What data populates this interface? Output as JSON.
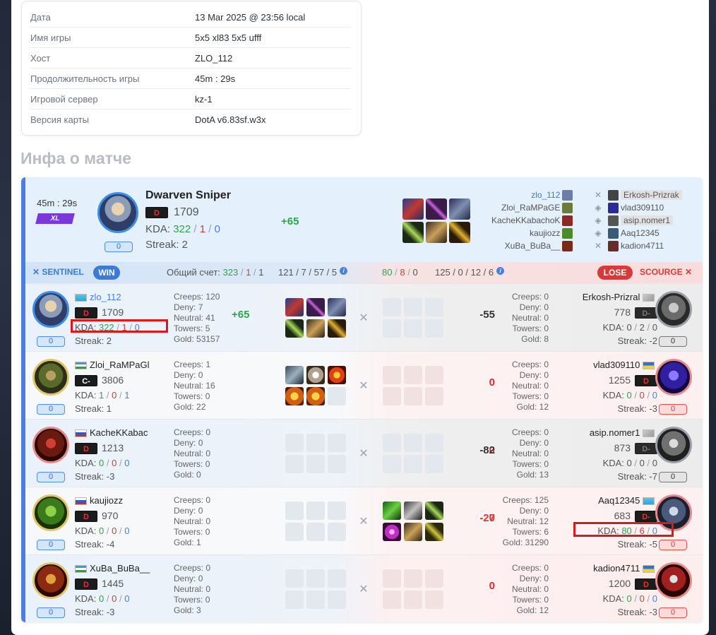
{
  "info": [
    {
      "key": "Дата",
      "value": "13 Mar 2025 @ 23:56 local"
    },
    {
      "key": "Имя игры",
      "value": "5x5 xl83 5x5 ufff"
    },
    {
      "key": "Хост",
      "value": "ZLO_112"
    },
    {
      "key": "Продолжительность игры",
      "value": "45m : 29s"
    },
    {
      "key": "Игровой сервер",
      "value": "kz-1"
    },
    {
      "key": "Версия карты",
      "value": "DotA v6.83sf.w3x"
    }
  ],
  "section_title": "Инфа о матче",
  "mvp": {
    "time": "45m : 29s",
    "badge": "XL",
    "hero": "Dwarven Sniper",
    "rank": "D",
    "rating": "1709",
    "kda_label": "KDA:",
    "k": "322",
    "d": "1",
    "a": "0",
    "streak": "Streak: 2",
    "pill": "0",
    "delta": "+65",
    "sentinel_names": [
      "zlo_112",
      "Zloi_RaMPaGE",
      "KacheKKabachoK",
      "kaujiozz",
      "XuBa_BuBa__"
    ],
    "scourge_names": [
      "Erkosh-Prizrak",
      "vlad309110",
      "asip.nomer1",
      "Aaq12345",
      "kadion4711"
    ]
  },
  "scorebar": {
    "sentinel": "SENTINEL",
    "win": "WIN",
    "total_label": "Общий счет:",
    "s_k": "323",
    "s_d": "1",
    "s_a": "1",
    "s_stats": "121 / 7 / 57 / 5",
    "c_k": "80",
    "c_d": "8",
    "c_a": "0",
    "c_stats": "125 / 0 / 12 / 6",
    "lose": "LOSE",
    "scourge": "SCOURGE"
  },
  "labels": {
    "kda": "KDA:",
    "creeps": "Creeps:",
    "deny": "Deny:",
    "neutral": "Neutral:",
    "towers": "Towers:",
    "gold": "Gold:"
  },
  "rows": [
    {
      "left": {
        "name": "zlo_112",
        "flag": "kz",
        "rank": "D",
        "rating": "1709",
        "k": "322",
        "d": "1",
        "a": "0",
        "streak": "Streak: 2",
        "pill": "0",
        "creeps": "120",
        "deny": "7",
        "neutral": "41",
        "towers": "5",
        "gold": "53157",
        "delta": "+65"
      },
      "right": {
        "name": "Erkosh-Prizral",
        "flag": "no",
        "rank": "D-",
        "rating": "778",
        "k": "0",
        "d": "2",
        "a": "0",
        "streak": "Streak: -2",
        "pill": "0",
        "creeps": "0",
        "deny": "0",
        "neutral": "0",
        "towers": "0",
        "gold": "8",
        "delta": "-55"
      }
    },
    {
      "left": {
        "name": "Zloi_RaMPaGl",
        "flag": "uz",
        "rank": "C-",
        "rating": "3806",
        "k": "1",
        "d": "0",
        "a": "1",
        "streak": "Streak: 1",
        "pill": "0",
        "creeps": "1",
        "deny": "0",
        "neutral": "16",
        "towers": "0",
        "gold": "22",
        "delta": "0"
      },
      "right": {
        "name": "vlad309110",
        "flag": "ua",
        "rank": "D",
        "rating": "1255",
        "k": "0",
        "d": "0",
        "a": "0",
        "streak": "Streak: -3",
        "pill": "0",
        "creeps": "0",
        "deny": "0",
        "neutral": "0",
        "towers": "0",
        "gold": "12",
        "delta": "0"
      }
    },
    {
      "left": {
        "name": "KacheKKabac",
        "flag": "ru",
        "rank": "D",
        "rating": "1213",
        "k": "0",
        "d": "0",
        "a": "0",
        "streak": "Streak: -3",
        "pill": "0",
        "creeps": "0",
        "deny": "0",
        "neutral": "0",
        "towers": "0",
        "gold": "0",
        "delta": "0"
      },
      "right": {
        "name": "asip.nomer1",
        "flag": "no",
        "rank": "D-",
        "rating": "873",
        "k": "0",
        "d": "0",
        "a": "0",
        "streak": "Streak: -7",
        "pill": "0",
        "creeps": "0",
        "deny": "0",
        "neutral": "0",
        "towers": "0",
        "gold": "13",
        "delta": "-82"
      }
    },
    {
      "left": {
        "name": "kaujiozz",
        "flag": "ru",
        "rank": "D",
        "rating": "970",
        "k": "0",
        "d": "0",
        "a": "0",
        "streak": "Streak: -4",
        "pill": "0",
        "creeps": "0",
        "deny": "0",
        "neutral": "0",
        "towers": "0",
        "gold": "1",
        "delta": "0"
      },
      "right": {
        "name": "Aaq12345",
        "flag": "kz",
        "rank": "D-",
        "rating": "683",
        "k": "80",
        "d": "6",
        "a": "0",
        "streak": "Streak: -5",
        "pill": "0",
        "creeps": "125",
        "deny": "0",
        "neutral": "12",
        "towers": "6",
        "gold": "31290",
        "delta": "-27"
      }
    },
    {
      "left": {
        "name": "XuBa_BuBa__",
        "flag": "uz",
        "rank": "D",
        "rating": "1445",
        "k": "0",
        "d": "0",
        "a": "0",
        "streak": "Streak: -3",
        "pill": "0",
        "creeps": "0",
        "deny": "0",
        "neutral": "0",
        "towers": "0",
        "gold": "3",
        "delta": "0"
      },
      "right": {
        "name": "kadion4711",
        "flag": "ua",
        "rank": "D",
        "rating": "1200",
        "k": "0",
        "d": "0",
        "a": "0",
        "streak": "Streak: -3",
        "pill": "0",
        "creeps": "0",
        "deny": "0",
        "neutral": "0",
        "towers": "0",
        "gold": "12",
        "delta": "0"
      }
    }
  ]
}
